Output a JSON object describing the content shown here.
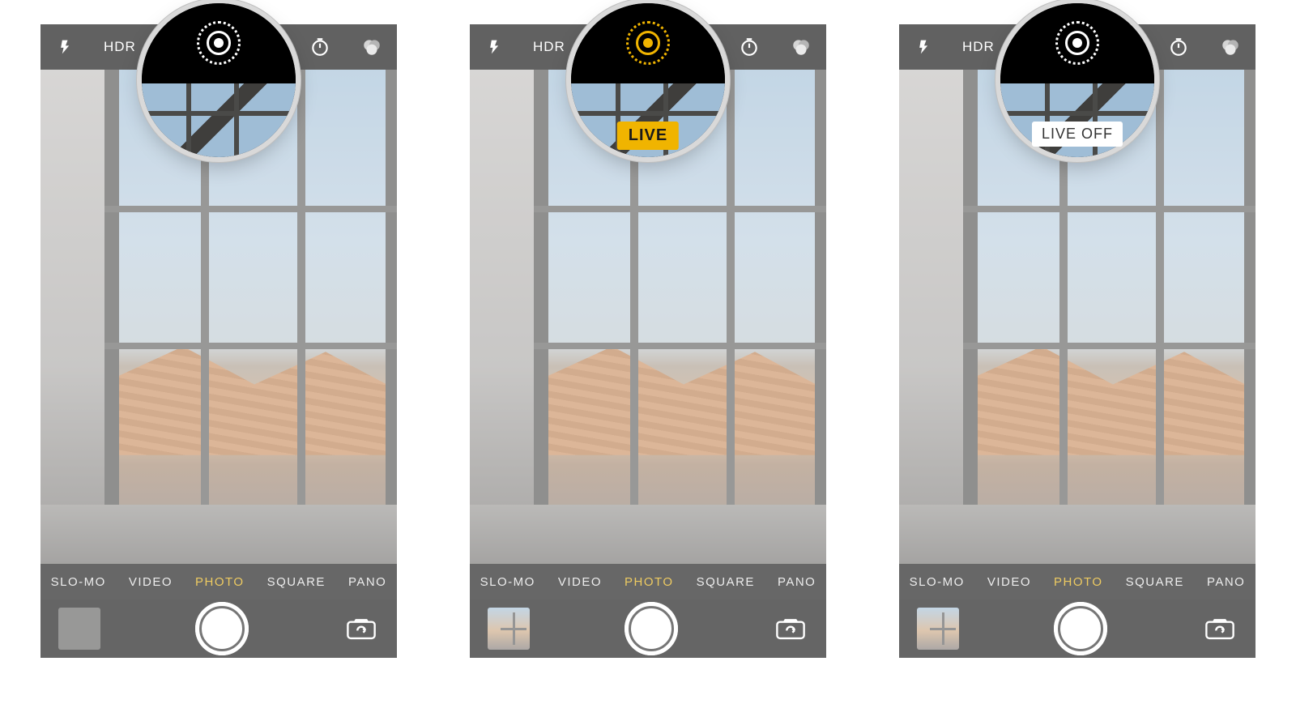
{
  "topbar": {
    "hdr_label": "HDR"
  },
  "modes": {
    "slo_mo": "SLO-MO",
    "video": "VIDEO",
    "photo": "PHOTO",
    "square": "SQUARE",
    "pano": "PANO"
  },
  "badges": {
    "live_on": "LIVE",
    "live_off": "LIVE OFF"
  },
  "screens": [
    {
      "live_icon_color": "white",
      "badge": null,
      "thumb_filled": false
    },
    {
      "live_icon_color": "yellow",
      "badge": "live_on",
      "thumb_filled": true
    },
    {
      "live_icon_color": "white",
      "badge": "live_off",
      "thumb_filled": true
    }
  ]
}
